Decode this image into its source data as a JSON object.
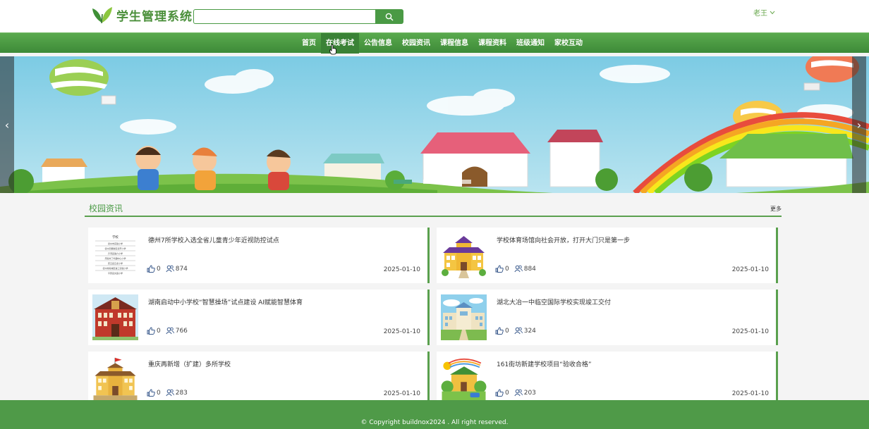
{
  "header": {
    "app_title": "学生管理系统",
    "search_placeholder": "",
    "search_icon": "search-icon",
    "user_name": "老王"
  },
  "nav": {
    "items": [
      "首页",
      "在线考试",
      "公告信息",
      "校园资讯",
      "课程信息",
      "课程资料",
      "班级通知",
      "家校互动"
    ],
    "active_index": 1
  },
  "banner": {
    "slide_count": 3,
    "active_slide": 0,
    "prev_label": "‹",
    "next_label": "›"
  },
  "news_section": {
    "title": "校园资讯",
    "more_label": "更多",
    "items": [
      {
        "title": "德州7所学校入选全省儿童青少年近视防控试点",
        "likes": "0",
        "views": "874",
        "date": "2025-01-10",
        "thumb": "school-list-thumbnail",
        "thumb_text": [
          "学校",
          "德州市实验小学",
          "德州天衢新区德开小学",
          "齐河县第六小学",
          "乐陵市丁坞镇中心小学",
          "庆云县云龙小学",
          "德州市陵城区第三实验小学",
          "平原县文昌小学"
        ]
      },
      {
        "title": "学校体育场馆向社会开放，打开大门只是第一步",
        "likes": "0",
        "views": "884",
        "date": "2025-01-10",
        "thumb": "school-building-thumbnail"
      },
      {
        "title": "湖南启动中小学校“智慧操场”试点建设 AI赋能智慧体育",
        "likes": "0",
        "views": "766",
        "date": "2025-01-10",
        "thumb": "red-school-thumbnail"
      },
      {
        "title": "湖北大冶一中临空国际学校实现竣工交付",
        "likes": "0",
        "views": "324",
        "date": "2025-01-10",
        "thumb": "campus-thumbnail"
      },
      {
        "title": "重庆再新增（扩建）多所学校",
        "likes": "0",
        "views": "283",
        "date": "2025-01-10",
        "thumb": "flag-school-thumbnail"
      },
      {
        "title": "161街坊新建学校项目“验收合格”",
        "likes": "0",
        "views": "203",
        "date": "2025-01-10",
        "thumb": "green-school-thumbnail"
      }
    ]
  },
  "footer": {
    "copyright": "© Copyright buildnox2024 . All right reserved."
  },
  "colors": {
    "brand_green": "#4a9a45",
    "nav_green": "#3d8a38",
    "footer_green": "#4f9a48"
  }
}
